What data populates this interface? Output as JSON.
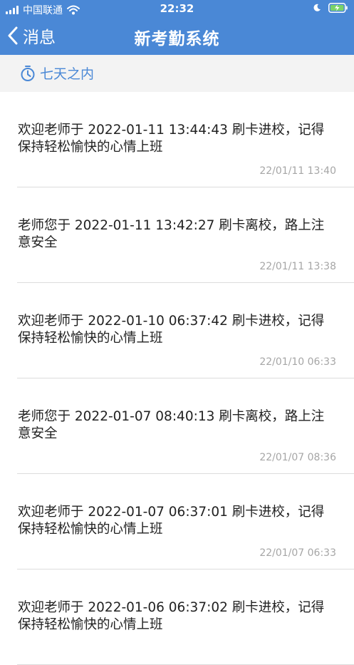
{
  "status_bar": {
    "carrier": "中国联通",
    "time": "22:32"
  },
  "nav": {
    "back_label": "消息",
    "title": "新考勤系统"
  },
  "filter": {
    "label": "七天之内"
  },
  "messages": [
    {
      "text": "欢迎老师于 2022-01-11 13:44:43 刷卡进校，记得保持轻松愉快的心情上班",
      "time": "22/01/11 13:40"
    },
    {
      "text": "老师您于 2022-01-11 13:42:27 刷卡离校，路上注意安全",
      "time": "22/01/11 13:38"
    },
    {
      "text": "欢迎老师于 2022-01-10 06:37:42 刷卡进校，记得保持轻松愉快的心情上班",
      "time": "22/01/10 06:33"
    },
    {
      "text": "老师您于 2022-01-07 08:40:13 刷卡离校，路上注意安全",
      "time": "22/01/07 08:36"
    },
    {
      "text": "欢迎老师于 2022-01-07 06:37:01 刷卡进校，记得保持轻松愉快的心情上班",
      "time": "22/01/07 06:33"
    },
    {
      "text": "欢迎老师于 2022-01-06 06:37:02 刷卡进校，记得保持轻松愉快的心情上班",
      "time": ""
    }
  ],
  "colors": {
    "header": "#4a88d6",
    "accent": "#4a88d6",
    "filter_bg": "#f3f3f3"
  },
  "icons": {
    "back": "chevron-left-icon",
    "filter": "timer-icon",
    "wifi": "wifi-icon",
    "moon": "moon-icon",
    "battery": "battery-charging-icon"
  }
}
